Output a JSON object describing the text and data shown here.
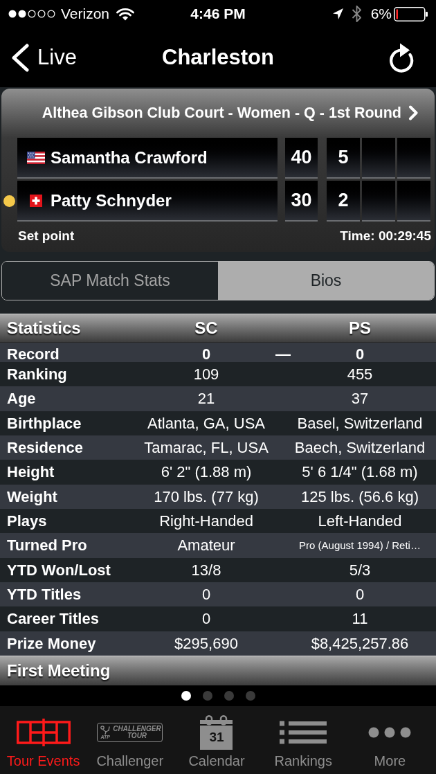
{
  "status_bar": {
    "carrier": "Verizon",
    "time": "4:46 PM",
    "battery": "6%"
  },
  "nav_bar": {
    "back": "Live",
    "title": "Charleston"
  },
  "match": {
    "round": "Althea Gibson Club Court - Women - Q - 1st Round",
    "players": [
      {
        "kind": "usa",
        "name": "Samantha Crawford",
        "points": "40",
        "sets": [
          "5"
        ],
        "serving": false
      },
      {
        "kind": "swiss",
        "name": "Patty Schnyder",
        "points": "30",
        "sets": [
          "2"
        ],
        "serving": true
      }
    ],
    "status": "Set point",
    "time": "Time: 00:29:45"
  },
  "tabs": [
    {
      "label": "SAP Match Stats",
      "selected": false
    },
    {
      "label": "Bios",
      "selected": true
    }
  ],
  "stats": {
    "columns": [
      "Statistics",
      "SC",
      "PS"
    ],
    "rows": [
      {
        "kind": "record",
        "label": "Record",
        "sc": "0",
        "separator": "—",
        "ps": "0"
      },
      {
        "kind": "stat",
        "label": "Ranking",
        "sc": "109",
        "ps": "455"
      },
      {
        "kind": "stat",
        "label": "Age",
        "sc": "21",
        "ps": "37"
      },
      {
        "kind": "stat",
        "label": "Birthplace",
        "sc": "Atlanta, GA, USA",
        "ps": "Basel, Switzerland"
      },
      {
        "kind": "stat",
        "label": "Residence",
        "sc": "Tamarac, FL, USA",
        "ps": "Baech, Switzerland"
      },
      {
        "kind": "stat",
        "label": "Height",
        "sc": "6' 2\" (1.88 m)",
        "ps": "5' 6 1/4\" (1.68 m)"
      },
      {
        "kind": "stat",
        "label": "Weight",
        "sc": "170 lbs. (77 kg)",
        "ps": "125 lbs. (56.6 kg)"
      },
      {
        "kind": "stat",
        "label": "Plays",
        "sc": "Right-Handed",
        "ps": "Left-Handed"
      },
      {
        "kind": "stat",
        "label": "Turned Pro",
        "sc": "Amateur",
        "ps": "Pro (August 1994) / Reti…"
      },
      {
        "kind": "stat",
        "label": "YTD Won/Lost",
        "sc": "13/8",
        "ps": "5/3"
      },
      {
        "kind": "stat",
        "label": "YTD Titles",
        "sc": "0",
        "ps": "0"
      },
      {
        "kind": "stat",
        "label": "Career Titles",
        "sc": "0",
        "ps": "11"
      },
      {
        "kind": "stat",
        "label": "Prize Money",
        "sc": "$295,690",
        "ps": "$8,425,257.86"
      }
    ]
  },
  "section": {
    "title": "First Meeting"
  },
  "pager": [
    {
      "selected": true
    },
    {
      "selected": false
    },
    {
      "selected": false
    },
    {
      "selected": false
    }
  ],
  "tab_bar": [
    {
      "kind": "court",
      "label": "Tour Events",
      "selected": true
    },
    {
      "kind": "logo",
      "logo_mark": "ATP",
      "logo_text": [
        "CHALLENGER",
        "TOUR"
      ],
      "label": "Challenger",
      "selected": false
    },
    {
      "kind": "calendar",
      "date": "31",
      "label": "Calendar",
      "selected": false
    },
    {
      "kind": "list",
      "label": "Rankings",
      "selected": false
    },
    {
      "kind": "more",
      "label": "More",
      "selected": false
    }
  ]
}
